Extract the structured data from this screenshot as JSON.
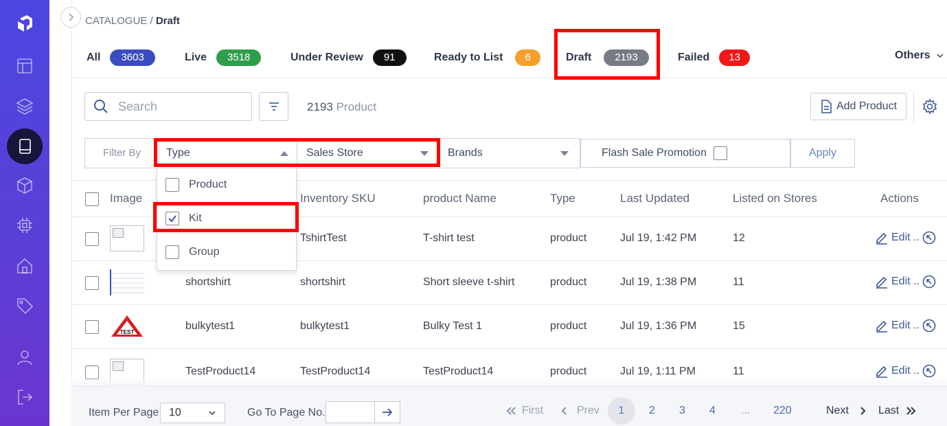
{
  "breadcrumb": {
    "root": "CATALOGUE",
    "separator": " / ",
    "current": "Draft"
  },
  "status_tabs": [
    {
      "label": "All",
      "count": "3603",
      "color": "#3b4cc0"
    },
    {
      "label": "Live",
      "count": "3518",
      "color": "#2e9e4a"
    },
    {
      "label": "Under Review",
      "count": "91",
      "color": "#111111"
    },
    {
      "label": "Ready to List",
      "count": "6",
      "color": "#f4a02a"
    },
    {
      "label": "Draft",
      "count": "2193",
      "color": "#777b85"
    },
    {
      "label": "Failed",
      "count": "13",
      "color": "#f01818"
    }
  ],
  "others_label": "Others",
  "toolbar": {
    "search_placeholder": "Search",
    "count_number": "2193",
    "count_word": "Product",
    "add_label": "Add Product"
  },
  "filters": {
    "filter_by": "Filter By",
    "type": "Type",
    "sales_store": "Sales Store",
    "brands": "Brands",
    "flash_sale": "Flash Sale Promotion",
    "apply": "Apply"
  },
  "type_options": [
    {
      "label": "Product",
      "checked": false
    },
    {
      "label": "Kit",
      "checked": true
    },
    {
      "label": "Group",
      "checked": false
    }
  ],
  "columns": [
    "Image",
    "Inventory SKU",
    "product Name",
    "Type",
    "Last Updated",
    "Listed on Stores",
    "Actions"
  ],
  "rows": [
    {
      "sku_a": "",
      "sku": "TshirtTest",
      "name": "T-shirt test",
      "type": "product",
      "updated": "Jul 19, 1:42 PM",
      "stores": "12",
      "image": "broken"
    },
    {
      "sku_a": "shortshirt",
      "sku": "shortshirt",
      "name": "Short sleeve t-shirt",
      "type": "product",
      "updated": "Jul 19, 1:38 PM",
      "stores": "11",
      "image": "screenshot"
    },
    {
      "sku_a": "bulkytest1",
      "sku": "bulkytest1",
      "name": "Bulky Test 1",
      "type": "product",
      "updated": "Jul 19, 1:36 PM",
      "stores": "15",
      "image": "test-sign"
    },
    {
      "sku_a": "TestProduct14",
      "sku": "TestProduct14",
      "name": "TestProduct14",
      "type": "product",
      "updated": "Jul 19, 1:11 PM",
      "stores": "11",
      "image": "broken"
    }
  ],
  "edit_label": "Edit ..",
  "footer": {
    "per_page_label": "Item Per Page",
    "per_page_value": "10",
    "goto_label": "Go To Page No.",
    "first": "First",
    "prev": "Prev",
    "pages": [
      "1",
      "2",
      "3",
      "4",
      "...",
      "220"
    ],
    "next": "Next",
    "last": "Last"
  },
  "test_sign_text": "TEST"
}
